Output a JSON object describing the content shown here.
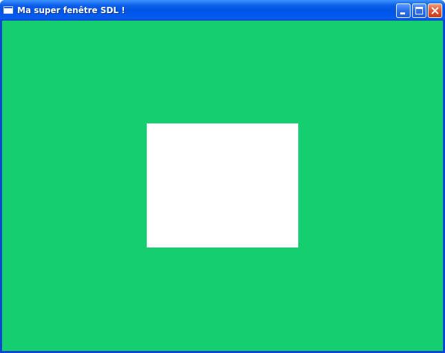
{
  "window": {
    "title": "Ma super fenêtre SDL !",
    "icon": "window-app-icon",
    "controls": {
      "minimize_icon": "minimize-icon",
      "maximize_icon": "maximize-icon",
      "close_icon": "close-icon"
    }
  },
  "canvas": {
    "background_color": "#14cf70",
    "rectangle_color": "#ffffff"
  }
}
